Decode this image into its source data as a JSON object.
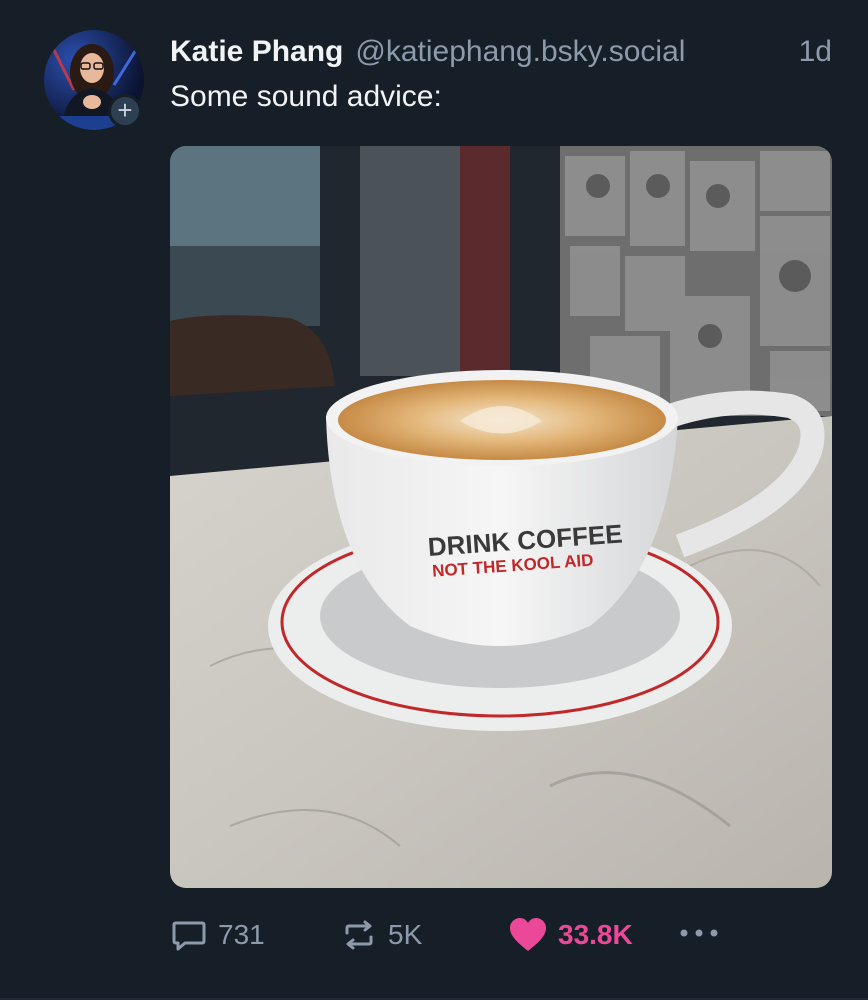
{
  "post": {
    "author": {
      "display_name": "Katie Phang",
      "handle": "@katiephang.bsky.social"
    },
    "timestamp": "1d",
    "text": "Some sound advice:",
    "follow_button_icon": "plus-icon",
    "image": {
      "cup_text_line1": "DRINK COFFEE",
      "cup_text_line2": "NOT THE KOOL AID"
    },
    "actions": {
      "reply_count": "731",
      "repost_count": "5K",
      "like_count": "33.8K",
      "reply_icon": "speech-bubble-icon",
      "repost_icon": "repost-arrows-icon",
      "like_icon": "heart-icon",
      "more_icon": "ellipsis-icon"
    }
  },
  "colors": {
    "background": "#161e27",
    "muted_text": "#8c9aab",
    "like_pink": "#ec4899",
    "cup_text_dark": "#3a3a3a",
    "cup_text_red": "#c0282a"
  }
}
